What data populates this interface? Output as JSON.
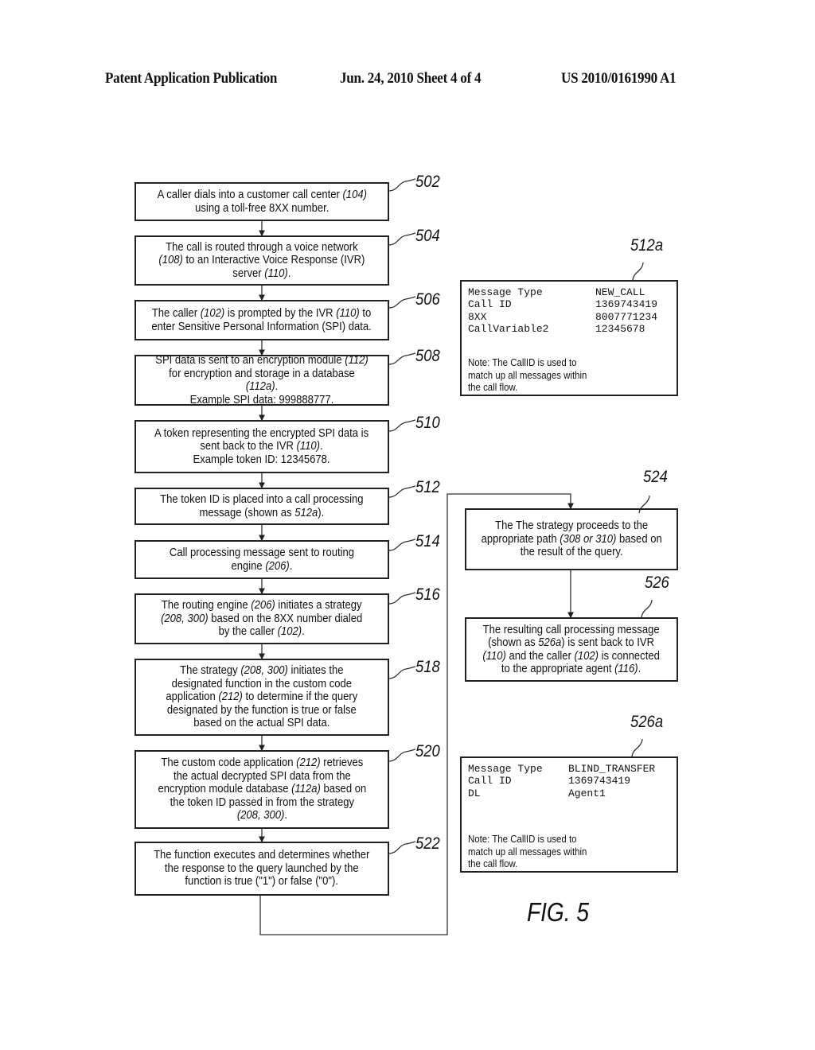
{
  "header": {
    "left": "Patent Application Publication",
    "center": "Jun. 24, 2010  Sheet 4 of 4",
    "right": "US 2010/0161990 A1"
  },
  "steps": [
    {
      "ref": "502",
      "html": "A caller dials into a customer call center <i>(104)</i>\nusing a toll-free 8XX number."
    },
    {
      "ref": "504",
      "html": "The call is routed through a voice network\n<i>(108)</i> to an Interactive Voice Response (IVR)\nserver <i>(110)</i>."
    },
    {
      "ref": "506",
      "html": "The caller <i>(102)</i> is prompted by the IVR <i>(110)</i> to\nenter Sensitive Personal Information (SPI) data."
    },
    {
      "ref": "508",
      "html": "SPI data is sent to an encryption module <i>(112)</i>\nfor encryption and storage in a database <i>(112a)</i>.\nExample SPI data: 999888777."
    },
    {
      "ref": "510",
      "html": "A token representing the encrypted SPI data is\nsent back to the IVR <i>(110)</i>.\nExample token ID: 12345678."
    },
    {
      "ref": "512",
      "html": "The token ID is placed into a call processing\nmessage (shown as <i>512a</i>)."
    },
    {
      "ref": "514",
      "html": "Call processing message sent to routing\nengine <i>(206)</i>."
    },
    {
      "ref": "516",
      "html": "The routing engine <i>(206)</i> initiates a strategy\n<i>(208, 300)</i> based on the 8XX number dialed\nby the caller <i>(102)</i>."
    },
    {
      "ref": "518",
      "html": "The strategy <i>(208, 300)</i> initiates the\ndesignated function in the custom code\napplication <i>(212)</i> to determine if the query\ndesignated by the function is true or false\nbased on the actual SPI data."
    },
    {
      "ref": "520",
      "html": "The custom code application <i>(212)</i> retrieves\nthe actual decrypted SPI data from the\nencryption module database <i>(112a)</i> based on\nthe token ID passed in from the strategy\n<i>(208, 300)</i>."
    },
    {
      "ref": "522",
      "html": "The function executes and determines whether\nthe response to the query launched by the\nfunction is true (\"1\") or false (\"0\")."
    },
    {
      "ref": "524",
      "html": "The The strategy proceeds to the\nappropriate path <i>(308 or 310)</i> based on\nthe result of the query."
    },
    {
      "ref": "526",
      "html": "The resulting call processing message\n(shown as <i>526a</i>) is sent back to IVR\n<i>(110)</i> and the caller <i>(102)</i> is connected\nto the appropriate agent <i>(116)</i>."
    }
  ],
  "message_512a": {
    "ref": "512a",
    "rows": [
      {
        "key": "Message Type",
        "value": "NEW_CALL"
      },
      {
        "key": "Call ID",
        "value": "1369743419"
      },
      {
        "key": "8XX",
        "value": "8007771234"
      },
      {
        "key": "CallVariable2",
        "value": "12345678"
      }
    ],
    "note": "Note: The CallID is used to\nmatch up all messages within\nthe call flow."
  },
  "message_526a": {
    "ref": "526a",
    "rows": [
      {
        "key": "Message Type",
        "value": "BLIND_TRANSFER"
      },
      {
        "key": "Call ID",
        "value": "1369743419"
      },
      {
        "key": "DL",
        "value": "Agent1"
      }
    ],
    "note": "Note: The CallID is used to\nmatch up all messages within\nthe call flow."
  },
  "figure_label": "FIG. 5"
}
